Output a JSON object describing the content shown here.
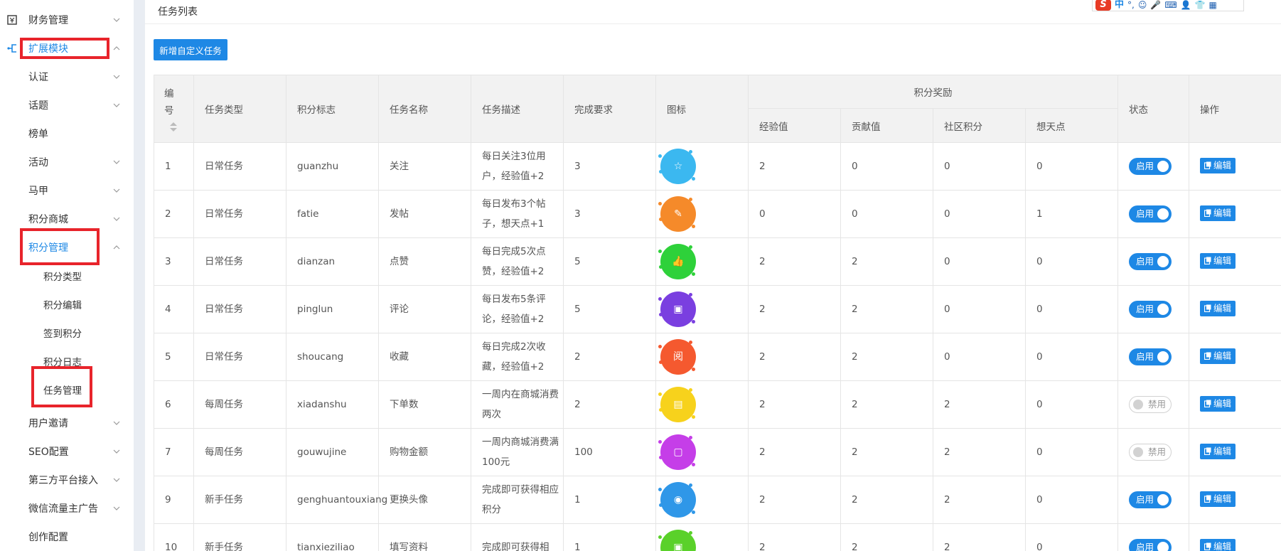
{
  "sidebar": {
    "items": [
      {
        "label": "财务管理",
        "icon": "finance-icon",
        "chevron": "down"
      },
      {
        "label": "扩展模块",
        "icon": "extension-icon",
        "chevron": "up",
        "active": true
      },
      {
        "label": "认证",
        "chevron": "down"
      },
      {
        "label": "话题",
        "chevron": "down"
      },
      {
        "label": "榜单"
      },
      {
        "label": "活动",
        "chevron": "down"
      },
      {
        "label": "马甲",
        "chevron": "down"
      },
      {
        "label": "积分商城",
        "chevron": "down"
      },
      {
        "label": "积分管理",
        "chevron": "up",
        "active": true
      },
      {
        "label": "积分类型",
        "sub": true
      },
      {
        "label": "积分编辑",
        "sub": true
      },
      {
        "label": "签到积分",
        "sub": true
      },
      {
        "label": "积分日志",
        "sub": true
      },
      {
        "label": "任务管理",
        "sub": true
      },
      {
        "label": "用户邀请",
        "chevron": "down"
      },
      {
        "label": "SEO配置",
        "chevron": "down"
      },
      {
        "label": "第三方平台接入",
        "chevron": "down"
      },
      {
        "label": "微信流量主广告",
        "chevron": "down"
      },
      {
        "label": "创作配置"
      }
    ],
    "active_color": "#1e88e5",
    "highlight_color": "#e8242b"
  },
  "header": {
    "title": "任务列表",
    "ime": {
      "logo": "S",
      "lang": "中",
      "punct": "°,"
    }
  },
  "toolbar": {
    "add_label": "新增自定义任务"
  },
  "table": {
    "headers": {
      "no": "编号",
      "type": "任务类型",
      "mark": "积分标志",
      "name": "任务名称",
      "desc": "任务描述",
      "req": "完成要求",
      "icon": "图标",
      "reward": "积分奖励",
      "exp": "经验值",
      "contrib": "贡献值",
      "community": "社区积分",
      "points": "想天点",
      "status": "状态",
      "action": "操作"
    },
    "on_label": "启用",
    "off_label": "禁用",
    "edit_label": "编辑",
    "rows": [
      {
        "no": "1",
        "type": "日常任务",
        "mark": "guanzhu",
        "name": "关注",
        "desc": "每日关注3位用户，经验值+2",
        "req": "3",
        "icon": {
          "name": "star-icon",
          "color": "#3bb8f0",
          "glyph": "☆"
        },
        "exp": "2",
        "contrib": "0",
        "community": "0",
        "points": "0",
        "status": "on"
      },
      {
        "no": "2",
        "type": "日常任务",
        "mark": "fatie",
        "name": "发帖",
        "desc": "每日发布3个帖子，想天点+1",
        "req": "3",
        "icon": {
          "name": "eraser-icon",
          "color": "#f58a2a",
          "glyph": "✎"
        },
        "exp": "0",
        "contrib": "0",
        "community": "0",
        "points": "1",
        "status": "on"
      },
      {
        "no": "3",
        "type": "日常任务",
        "mark": "dianzan",
        "name": "点赞",
        "desc": "每日完成5次点赞，经验值+2",
        "req": "5",
        "icon": {
          "name": "thumbs-up-icon",
          "color": "#2ed13a",
          "glyph": "👍"
        },
        "exp": "2",
        "contrib": "2",
        "community": "0",
        "points": "0",
        "status": "on"
      },
      {
        "no": "4",
        "type": "日常任务",
        "mark": "pinglun",
        "name": "评论",
        "desc": "每日发布5条评论，经验值+2",
        "req": "5",
        "icon": {
          "name": "comment-icon",
          "color": "#7a3fe0",
          "glyph": "▣"
        },
        "exp": "2",
        "contrib": "2",
        "community": "0",
        "points": "0",
        "status": "on"
      },
      {
        "no": "5",
        "type": "日常任务",
        "mark": "shoucang",
        "name": "收藏",
        "desc": "每日完成2次收藏，经验值+2",
        "req": "2",
        "icon": {
          "name": "favorite-icon",
          "color": "#f5592f",
          "glyph": "阅"
        },
        "exp": "2",
        "contrib": "2",
        "community": "0",
        "points": "0",
        "status": "on"
      },
      {
        "no": "6",
        "type": "每周任务",
        "mark": "xiadanshu",
        "name": "下单数",
        "desc": "一周内在商城消费两次",
        "req": "2",
        "icon": {
          "name": "document-icon",
          "color": "#f7d21c",
          "glyph": "▤"
        },
        "exp": "2",
        "contrib": "2",
        "community": "2",
        "points": "0",
        "status": "off"
      },
      {
        "no": "7",
        "type": "每周任务",
        "mark": "gouwujine",
        "name": "购物金额",
        "desc": "一周内商城消费满100元",
        "req": "100",
        "icon": {
          "name": "shopping-bag-icon",
          "color": "#c53ee8",
          "glyph": "▢"
        },
        "exp": "2",
        "contrib": "2",
        "community": "2",
        "points": "0",
        "status": "off"
      },
      {
        "no": "9",
        "type": "新手任务",
        "mark": "genghuantouxiang",
        "name": "更换头像",
        "desc": "完成即可获得相应积分",
        "req": "1",
        "icon": {
          "name": "avatar-icon",
          "color": "#2f97e8",
          "glyph": "◉"
        },
        "exp": "2",
        "contrib": "2",
        "community": "2",
        "points": "0",
        "status": "on"
      },
      {
        "no": "10",
        "type": "新手任务",
        "mark": "tianxieziliao",
        "name": "填写资料",
        "desc": "完成即可获得相",
        "req": "1",
        "icon": {
          "name": "profile-icon",
          "color": "#5ad12a",
          "glyph": "▣"
        },
        "exp": "2",
        "contrib": "2",
        "community": "2",
        "points": "0",
        "status": "on"
      }
    ]
  }
}
